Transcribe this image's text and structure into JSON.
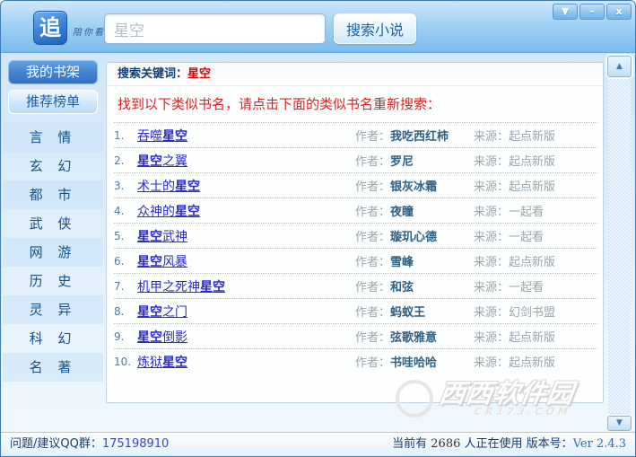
{
  "window": {
    "controls": {
      "skin_glyph": "▼",
      "minimize_glyph": "–",
      "close_glyph": "x"
    }
  },
  "header": {
    "logo_char": "追",
    "tagline": "陪你看小说",
    "search_value": "星空",
    "search_button_label": "搜索小说"
  },
  "sidebar": {
    "bookshelf_label": "我的书架",
    "ranking_label": "推荐榜单",
    "categories": [
      "言 情",
      "玄 幻",
      "都 市",
      "武 侠",
      "网 游",
      "历 史",
      "灵 异",
      "科 幻",
      "名 著"
    ]
  },
  "main": {
    "keyword_label": "搜索关键词：",
    "keyword": "星空",
    "notice": "找到以下类似书名，请点击下面的类似书名重新搜索：",
    "author_label": "作者：",
    "source_label": "来源：",
    "books": [
      {
        "num": "1.",
        "title": "吞噬星空",
        "author": "我吃西红柿",
        "source": "起点新版"
      },
      {
        "num": "2.",
        "title": "星空之翼",
        "author": "罗尼",
        "source": "起点新版"
      },
      {
        "num": "3.",
        "title": "术士的星空",
        "author": "银灰冰霜",
        "source": "起点新版"
      },
      {
        "num": "4.",
        "title": "众神的星空",
        "author": "夜瞳",
        "source": "一起看"
      },
      {
        "num": "5.",
        "title": "星空武神",
        "author": "璇玑心德",
        "source": "一起看"
      },
      {
        "num": "6.",
        "title": "星空风暴",
        "author": "雪峰",
        "source": "起点新版"
      },
      {
        "num": "7.",
        "title": "机甲之死神星空",
        "author": "和弦",
        "source": "一起看"
      },
      {
        "num": "8.",
        "title": "星空之门",
        "author": "蚂蚁王",
        "source": "幻剑书盟"
      },
      {
        "num": "9.",
        "title": "星空倒影",
        "author": "弦歌雅意",
        "source": "起点新版"
      },
      {
        "num": "10.",
        "title": "炼狱星空",
        "author": "书哇哈哈",
        "source": "起点新版"
      }
    ]
  },
  "scrollbar": {
    "up_glyph": "▲",
    "down_glyph": "▼"
  },
  "watermark": {
    "text": "西西软件园",
    "sub": "CR173.COM"
  },
  "footer": {
    "qq_label": "问题/建议QQ群：",
    "qq_number": "175198910",
    "online_prefix": "当前有",
    "online_count": "2686",
    "online_suffix": "人正在使用",
    "version_label": "版本号：",
    "version": "Ver 2.4.3"
  },
  "colors": {
    "title_link": "#2b2bd0",
    "keyword_red": "#dd0000",
    "notice_red": "#e02020",
    "titlebar_blue": "#7cbbee",
    "sidebar_active": "#3470c2"
  }
}
